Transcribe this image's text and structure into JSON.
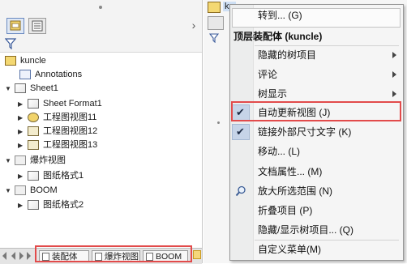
{
  "tree": {
    "root_label": "kuncle",
    "annotations_label": "Annotations",
    "sheet1_label": "Sheet1",
    "sheet_format1_label": "Sheet Format1",
    "view11_label": "工程图视图11",
    "view12_label": "工程图视图12",
    "view13_label": "工程图视图13",
    "exploded_view_label": "爆炸视图",
    "sheet_format_1_label": "图纸格式1",
    "boom_label": "BOOM",
    "sheet_format_2_label": "图纸格式2"
  },
  "bottom_tabs": {
    "assembly": "装配体",
    "exploded": "爆炸视图",
    "boom": "BOOM"
  },
  "underlying": {
    "root_label_partial": "ku"
  },
  "menu": {
    "goto": "转到... (G)",
    "header": "顶层装配体 (kuncle)",
    "hidden_tree_items": "隐藏的树项目",
    "comment": "评论",
    "tree_display": "树显示",
    "auto_update_view": "自动更新视图 (J)",
    "link_external_dim_text": "链接外部尺寸文字 (K)",
    "move": "移动... (L)",
    "document_properties": "文档属性... (M)",
    "zoom_to_selection": "放大所选范围 (N)",
    "collapse_items": "折叠项目 (P)",
    "hide_show_tree_items": "隐藏/显示树项目... (Q)",
    "customize_menu": "自定义菜单(M)"
  },
  "colors": {
    "highlight_border": "#e24b4b",
    "checked_bg": "#c6d4e8"
  },
  "icons": {
    "check": "✔",
    "submenu": "triangle-right"
  }
}
